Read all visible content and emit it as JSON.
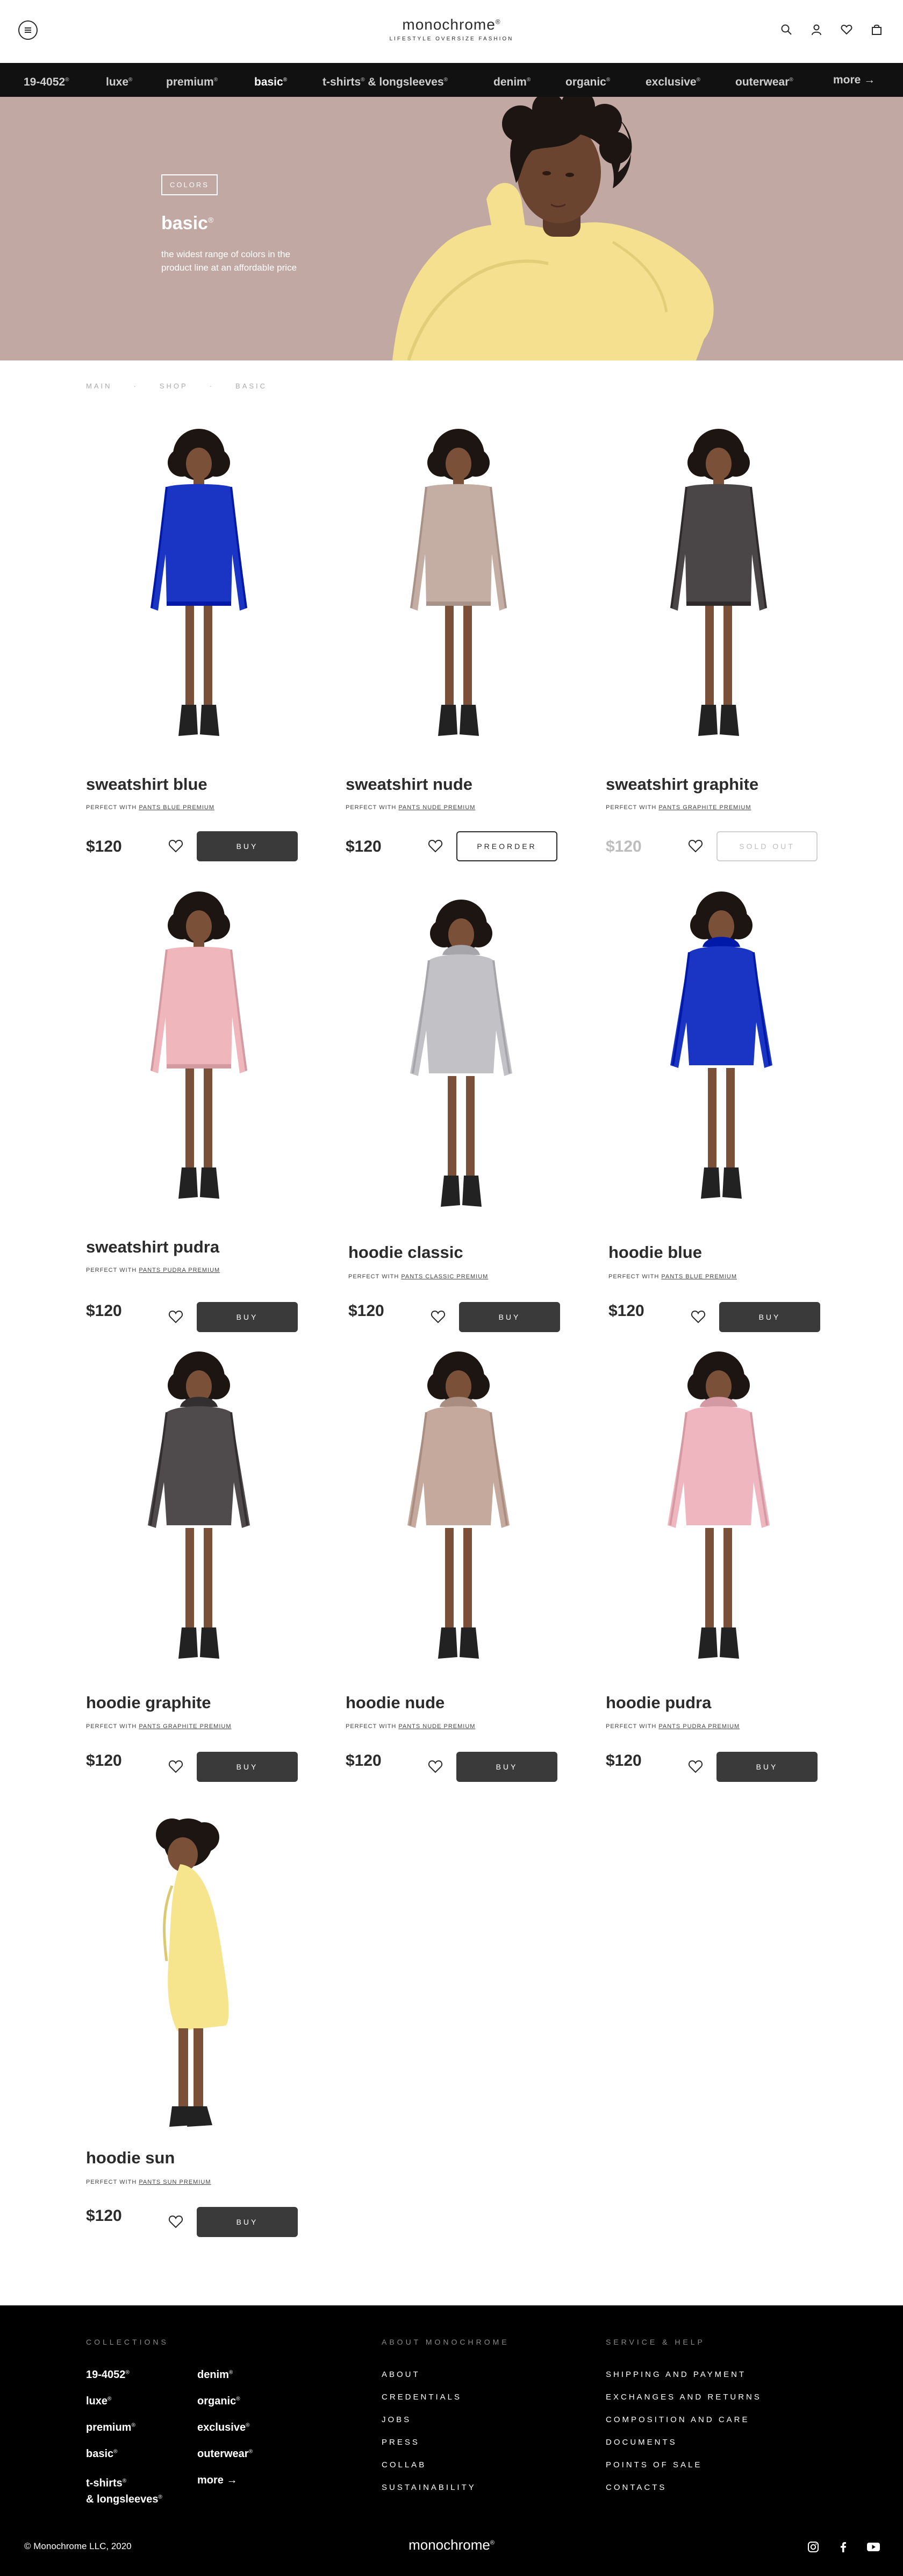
{
  "header": {
    "logo_name": "monochrome",
    "logo_reg": "®",
    "logo_tagline": "LIFESTYLE OVERSIZE FASHION",
    "icons": [
      "menu-icon",
      "search-icon",
      "user-icon",
      "heart-icon",
      "bag-icon"
    ]
  },
  "nav": {
    "items": [
      {
        "label": "19-4052",
        "sup": "®"
      },
      {
        "label": "luxe",
        "sup": "®"
      },
      {
        "label": "premium",
        "sup": "®"
      },
      {
        "label": "basic",
        "sup": "®"
      },
      {
        "label": "t-shirts",
        "sup": "®",
        "label2": " & longsleeves",
        "sup2": "®"
      },
      {
        "label": "denim",
        "sup": "®"
      },
      {
        "label": "organic",
        "sup": "®"
      },
      {
        "label": "exclusive",
        "sup": "®"
      },
      {
        "label": "outerwear",
        "sup": "®"
      },
      {
        "label": "more →",
        "sup": ""
      }
    ],
    "active": "basic"
  },
  "hero": {
    "tag": "COLORS",
    "title": "basic",
    "title_sup": "®",
    "subtitle": "the widest range of colors in the product line at an affordable price",
    "bg_color": "#c2a8a2"
  },
  "breadcrumb": [
    "MAIN",
    "SHOP",
    "BASIC"
  ],
  "products": [
    {
      "name": "sweatshirt blue",
      "perfect": "PERFECT WITH ",
      "link": "PANTS BLUE PREMIUM",
      "price": "$120",
      "button": "BUY",
      "state": "buy",
      "color": "#1a35c4",
      "kind": "sweatshirt"
    },
    {
      "name": "sweatshirt nude",
      "perfect": "PERFECT WITH ",
      "link": "PANTS NUDE PREMIUM",
      "price": "$120",
      "button": "PREORDER",
      "state": "preorder",
      "color": "#c4aea4",
      "kind": "sweatshirt"
    },
    {
      "name": "sweatshirt graphite",
      "perfect": "PERFECT WITH ",
      "link": "PANTS GRAPHITE PREMIUM",
      "price": "$120",
      "button": "SOLD OUT",
      "state": "soldout",
      "color": "#4a4546",
      "kind": "sweatshirt"
    },
    {
      "name": "sweatshirt pudra",
      "perfect": "PERFECT WITH ",
      "link": "PANTS PUDRA PREMIUM",
      "price": "$120",
      "button": "BUY",
      "state": "buy",
      "color": "#efb6bc",
      "kind": "sweatshirt"
    },
    {
      "name": "hoodie classic",
      "perfect": "PERFECT WITH ",
      "link": "PANTS CLASSIC PREMIUM",
      "price": "$120",
      "button": "BUY",
      "state": "buy",
      "color": "#c2c2c6",
      "kind": "hoodie"
    },
    {
      "name": "hoodie blue",
      "perfect": "PERFECT WITH ",
      "link": "PANTS BLUE PREMIUM",
      "price": "$120",
      "button": "BUY",
      "state": "buy",
      "color": "#1a35c4",
      "kind": "hoodie"
    },
    {
      "name": "hoodie graphite",
      "perfect": "PERFECT WITH ",
      "link": "PANTS GRAPHITE PREMIUM",
      "price": "$120",
      "button": "BUY",
      "state": "buy",
      "color": "#4f4b4c",
      "kind": "hoodie"
    },
    {
      "name": "hoodie nude",
      "perfect": "PERFECT WITH ",
      "link": "PANTS NUDE PREMIUM",
      "price": "$120",
      "button": "BUY",
      "state": "buy",
      "color": "#c4a99c",
      "kind": "hoodie"
    },
    {
      "name": "hoodie pudra",
      "perfect": "PERFECT WITH ",
      "link": "PANTS PUDRA PREMIUM",
      "price": "$120",
      "button": "BUY",
      "state": "buy",
      "color": "#f0b6c0",
      "kind": "hoodie"
    },
    {
      "name": "hoodie sun",
      "perfect": "PERFECT WITH ",
      "link": "PANTS SUN PREMIUM",
      "price": "$120",
      "button": "BUY",
      "state": "buy",
      "color": "#f6e58c",
      "kind": "side"
    }
  ],
  "footer": {
    "collections_head": "COLLECTIONS",
    "collections_left": [
      {
        "label": "19-4052",
        "sup": "®"
      },
      {
        "label": "luxe",
        "sup": "®"
      },
      {
        "label": "premium",
        "sup": "®"
      },
      {
        "label": "basic",
        "sup": "®"
      },
      {
        "label": "t-shirts",
        "sup": "®",
        "line2": "& longsleeves",
        "sup2": "®"
      }
    ],
    "collections_right": [
      {
        "label": "denim",
        "sup": "®"
      },
      {
        "label": "organic",
        "sup": "®"
      },
      {
        "label": "exclusive",
        "sup": "®"
      },
      {
        "label": "outerwear",
        "sup": "®"
      },
      {
        "label": "more →",
        "sup": ""
      }
    ],
    "about_head": "ABOUT MONOCHROME",
    "about_links": [
      "ABOUT",
      "CREDENTIALS",
      "JOBS",
      "PRESS",
      "COLLAB",
      "SUSTAINABILITY"
    ],
    "service_head": "SERVICE & HELP",
    "service_links": [
      "SHIPPING AND PAYMENT",
      "EXCHANGES AND RETURNS",
      "COMPOSITION AND CARE",
      "DOCUMENTS",
      "POINTS OF SALE",
      "CONTACTS"
    ],
    "copyright": "© Monochrome LLC, 2020",
    "logo": "monochrome",
    "logo_reg": "®",
    "social": [
      "instagram-icon",
      "facebook-icon",
      "youtube-icon"
    ]
  }
}
